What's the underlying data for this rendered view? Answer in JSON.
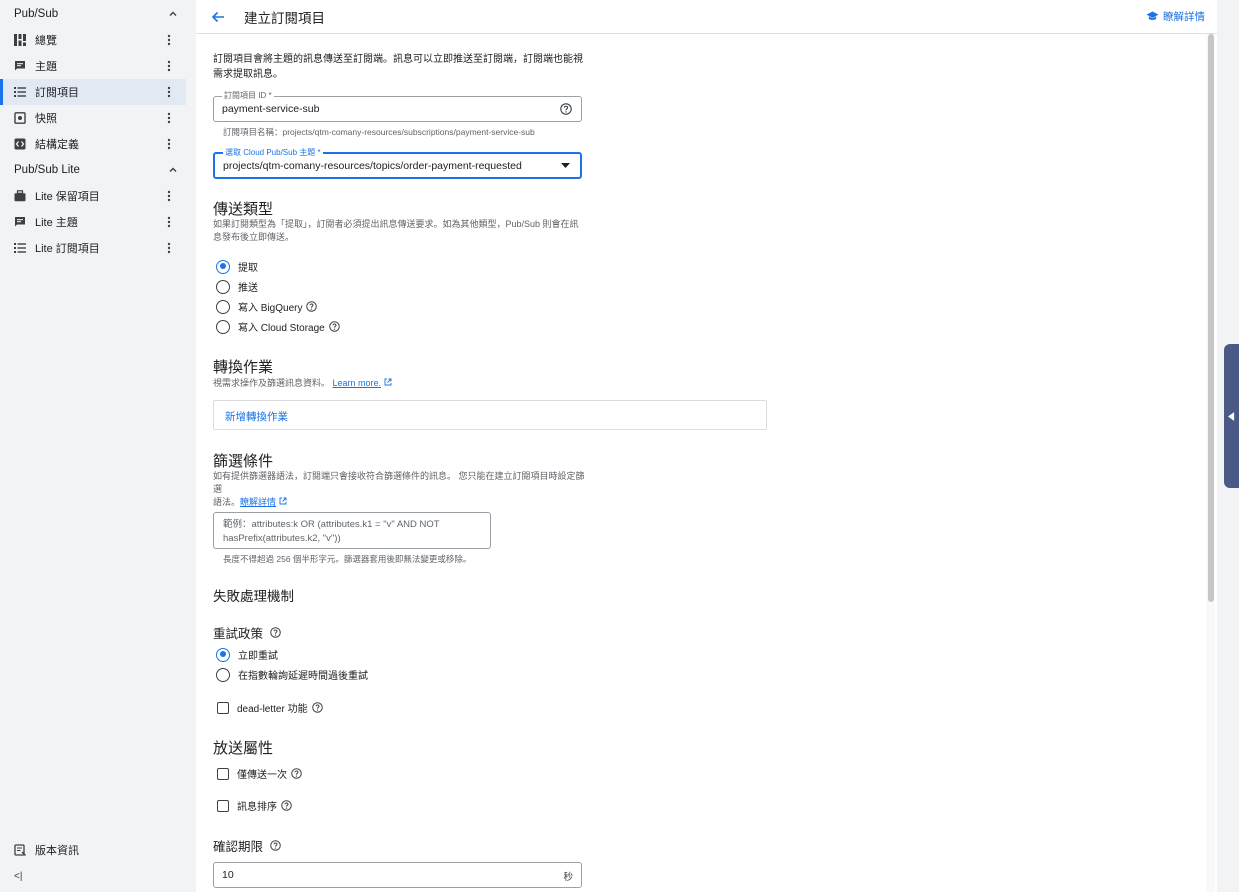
{
  "sidebar": {
    "section1": "Pub/Sub",
    "items1": [
      {
        "label": "總覽",
        "icon": "dashboard-icon"
      },
      {
        "label": "主題",
        "icon": "topic-icon"
      },
      {
        "label": "訂閱項目",
        "icon": "list-icon",
        "active": true
      },
      {
        "label": "快照",
        "icon": "snapshot-icon"
      },
      {
        "label": "結構定義",
        "icon": "schema-icon"
      }
    ],
    "section2": "Pub/Sub Lite",
    "items2": [
      {
        "label": "Lite 保留項目",
        "icon": "reservation-icon"
      },
      {
        "label": "Lite 主題",
        "icon": "topic-icon"
      },
      {
        "label": "Lite 訂閱項目",
        "icon": "list-icon"
      }
    ],
    "release_notes": "版本資訊",
    "collapse": "<|"
  },
  "header": {
    "title": "建立訂閱項目",
    "learn_more": "瞭解詳情"
  },
  "form": {
    "intro": "訂閱項目會將主題的訊息傳送至訂閱端。訊息可以立即推送至訂閱端，訂閱端也能視需求提取訊息。",
    "sub_id": {
      "label": "訂閱項目 ID *",
      "value": "payment-service-sub",
      "hint": "訂閱項目名稱：projects/qtm-comany-resources/subscriptions/payment-service-sub"
    },
    "topic": {
      "label": "選取 Cloud Pub/Sub 主題 *",
      "value": "projects/qtm-comany-resources/topics/order-payment-requested"
    },
    "delivery": {
      "title": "傳送類型",
      "desc": "如果訂閱類型為「提取」，訂閱者必須提出訊息傳送要求。如為其他類型，Pub/Sub 則會在訊息發布後立即傳送。",
      "options": [
        "提取",
        "推送",
        "寫入 BigQuery",
        "寫入 Cloud Storage"
      ],
      "selected": 0
    },
    "transforms": {
      "title": "轉換作業",
      "desc": "視需求操作及篩選訊息資料。",
      "learn": "Learn more.",
      "add": "新增轉換作業"
    },
    "filter": {
      "title": "篩選條件",
      "desc1": "如有提供篩選器語法，訂閱端只會接收符合篩選條件的訊息。 您只能在建立訂閱項目時設定篩選",
      "desc2": "語法。",
      "learn": "瞭解詳情",
      "placeholder_line1": "範例：attributes:k OR (attributes.k1 = \"v\" AND NOT",
      "placeholder_line2": "hasPrefix(attributes.k2, \"v\"))",
      "hint": "長度不得超過 256 個半形字元。篩選器套用後即無法變更或移除。"
    },
    "failure": {
      "title": "失敗處理機制",
      "retry_title": "重試政策",
      "retry_options": [
        "立即重試",
        "在指數輪詢延遲時間過後重試"
      ],
      "retry_selected": 0,
      "dead_letter": "dead-letter 功能"
    },
    "delivery_props": {
      "title": "放送屬性",
      "exactly_once": "僅傳送一次",
      "ordering": "訊息排序"
    },
    "ack": {
      "title": "確認期限",
      "value": "10",
      "unit": "秒"
    }
  },
  "colors": {
    "accent": "#1a73e8",
    "sidetab": "#4a5a87"
  }
}
